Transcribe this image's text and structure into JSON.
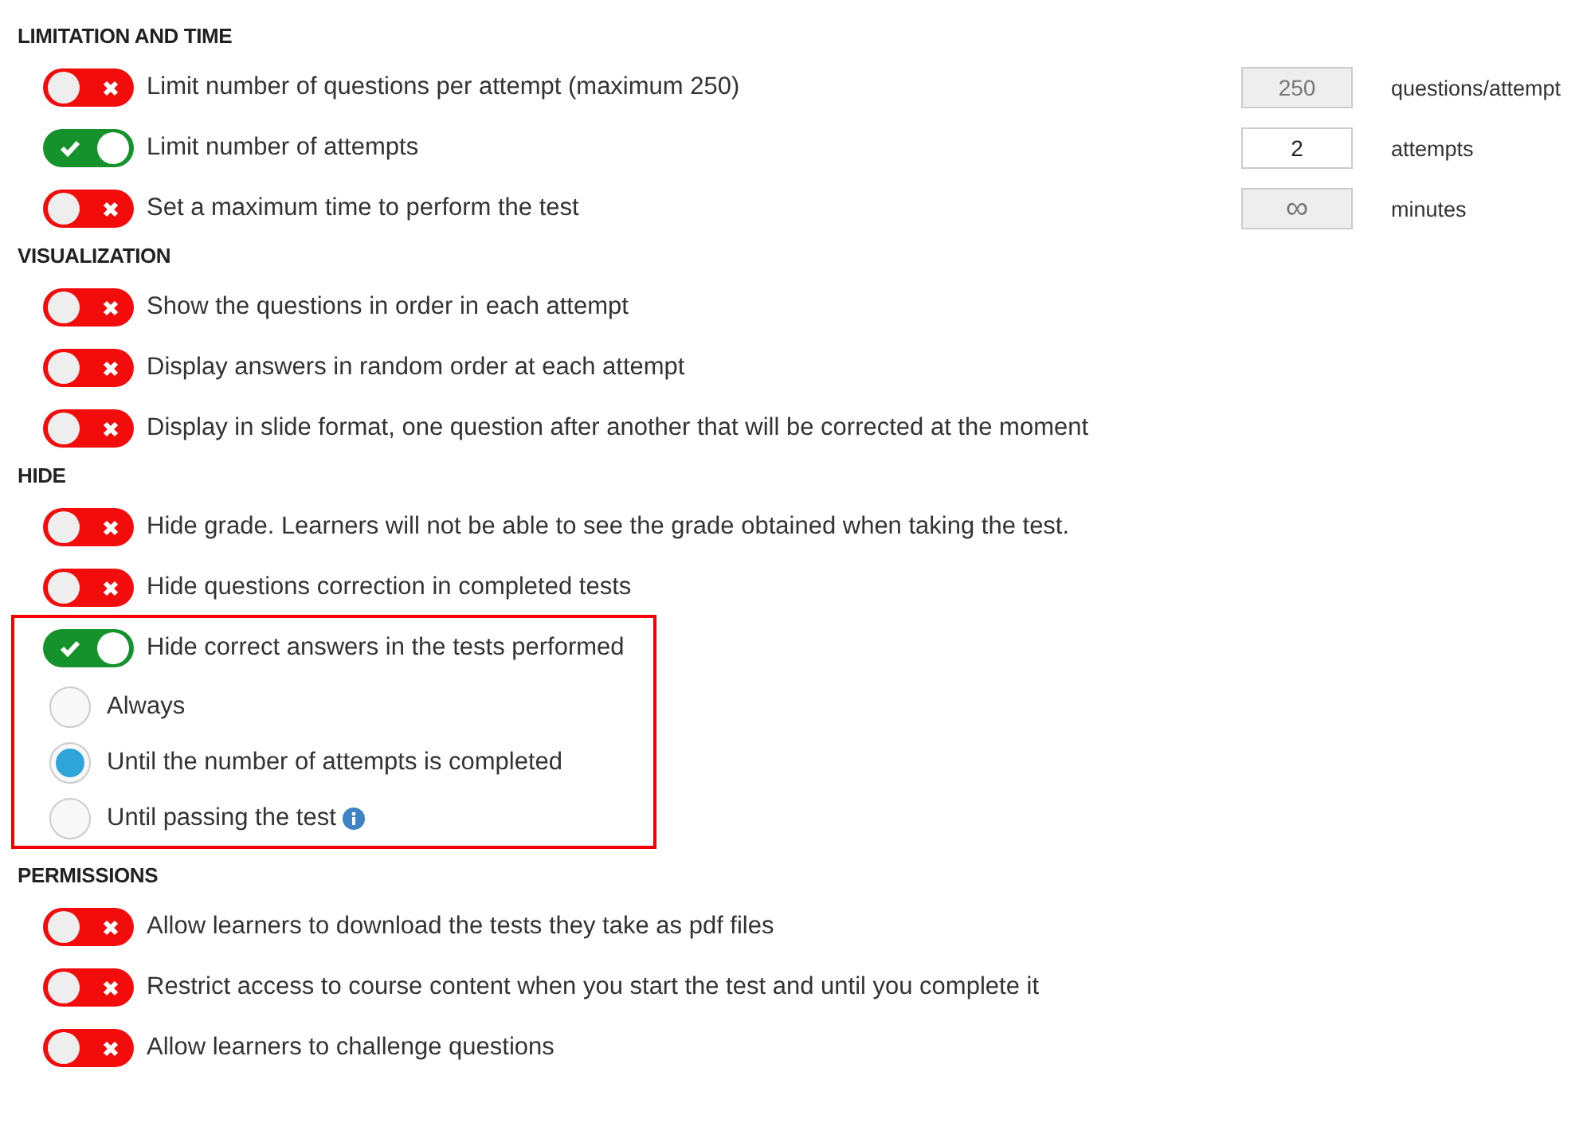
{
  "sections": [
    {
      "title": "LIMITATION AND TIME",
      "options": [
        {
          "label": "Limit number of questions per attempt (maximum 250)",
          "on": false,
          "field": {
            "value": "250",
            "disabled": true
          },
          "unit": "questions/attempt"
        },
        {
          "label": "Limit number of attempts",
          "on": true,
          "field": {
            "value": "2",
            "disabled": false
          },
          "unit": "attempts"
        },
        {
          "label": "Set a maximum time to perform the test",
          "on": false,
          "field": {
            "value": "∞",
            "disabled": true
          },
          "unit": "minutes"
        }
      ]
    },
    {
      "title": "VISUALIZATION",
      "options": [
        {
          "label": "Show the questions in order in each attempt",
          "on": false
        },
        {
          "label": "Display answers in random order at each attempt",
          "on": false
        },
        {
          "label": "Display in slide format, one question after another that will be corrected at the moment",
          "on": false
        }
      ]
    },
    {
      "title": "HIDE",
      "options": [
        {
          "label": "Hide grade. Learners will not be able to see the grade obtained when taking the test.",
          "on": false
        },
        {
          "label": "Hide questions correction in completed tests",
          "on": false
        },
        {
          "label": "Hide correct answers in the tests performed",
          "on": true,
          "highlighted": true,
          "choices": [
            {
              "label": "Always",
              "selected": false
            },
            {
              "label": "Until the number of attempts is completed",
              "selected": true
            },
            {
              "label": "Until passing the test",
              "selected": false,
              "info": true
            }
          ]
        }
      ]
    },
    {
      "title": "PERMISSIONS",
      "options": [
        {
          "label": "Allow learners to download the tests they take as pdf files",
          "on": false
        },
        {
          "label": "Restrict access to course content when you start the test and until you complete it",
          "on": false
        },
        {
          "label": "Allow learners to challenge questions",
          "on": false
        }
      ]
    }
  ]
}
